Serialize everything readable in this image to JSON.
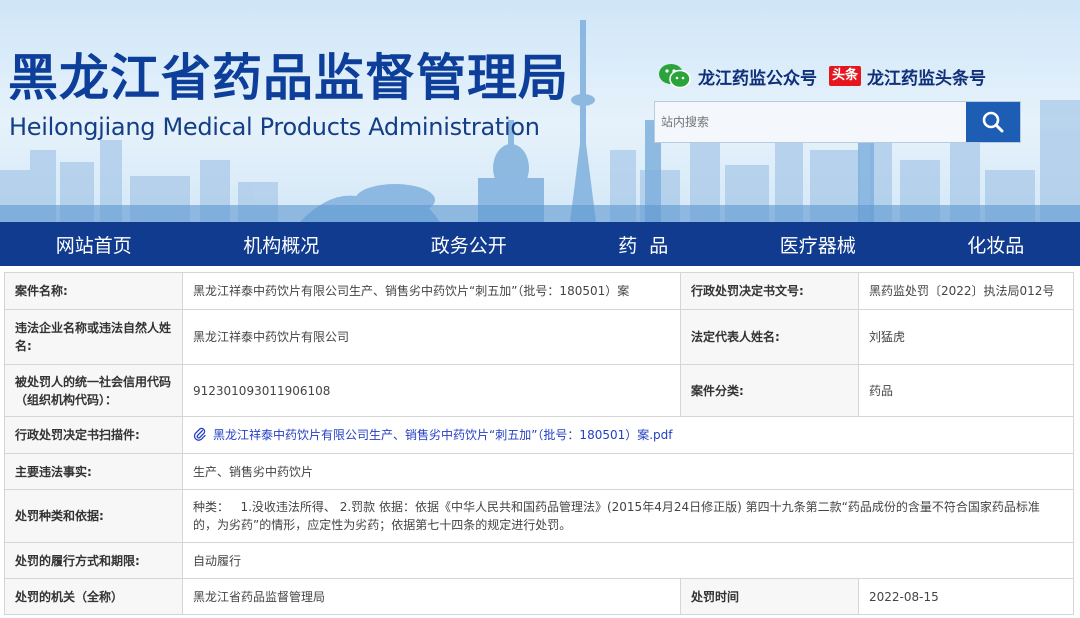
{
  "header": {
    "title": "黑龙江省药品监督管理局",
    "subtitle": "Heilongjiang Medical Products Administration",
    "wechat_label": "龙江药监公众号",
    "toutiao_badge": "头条",
    "toutiao_label": "龙江药监头条号",
    "search_placeholder": "站内搜索",
    "icons": [
      "wechat-icon",
      "search-icon"
    ]
  },
  "nav": {
    "items": [
      "网站首页",
      "机构概况",
      "政务公开",
      "药  品",
      "医疗器械",
      "化妆品"
    ]
  },
  "record": {
    "case_name_label": "案件名称:",
    "case_name": "黑龙江祥泰中药饮片有限公司生产、销售劣中药饮片“刺五加”（批号：180501）案",
    "doc_no_label": "行政处罚决定书文号:",
    "doc_no": "黑药监处罚〔2022〕执法局012号",
    "party_label": "违法企业名称或违法自然人姓名:",
    "party": "黑龙江祥泰中药饮片有限公司",
    "legal_rep_label": "法定代表人姓名:",
    "legal_rep": "刘猛虎",
    "credit_code_label": "被处罚人的统一社会信用代码（组织机构代码）：",
    "credit_code": "912301093011906108",
    "category_label": "案件分类:",
    "category": "药品",
    "scan_label": "行政处罚决定书扫描件:",
    "scan_file": "黑龙江祥泰中药饮片有限公司生产、销售劣中药饮片“刺五加”（批号：180501）案.pdf",
    "facts_label": "主要违法事实:",
    "facts": "生产、销售劣中药饮片",
    "penalty_label": "处罚种类和依据:",
    "penalty": "种类：   1.没收违法所得、 2.罚款 依据：依据《中华人民共和国药品管理法》(2015年4月24日修正版) 第四十九条第二款“药品成份的含量不符合国家药品标准的，为劣药”的情形，应定性为劣药；依据第七十四条的规定进行处罚。",
    "perform_label": "处罚的履行方式和期限:",
    "perform": "自动履行",
    "agency_label": "处罚的机关（全称）",
    "agency": "黑龙江省药品监督管理局",
    "time_label": "处罚时间",
    "time": "2022-08-15"
  },
  "colors": {
    "brand_blue": "#103b8e",
    "title_blue": "#0d3f9a",
    "search_button": "#1d5db4",
    "link": "#2440c4",
    "toutiao_red": "#e4161e"
  }
}
